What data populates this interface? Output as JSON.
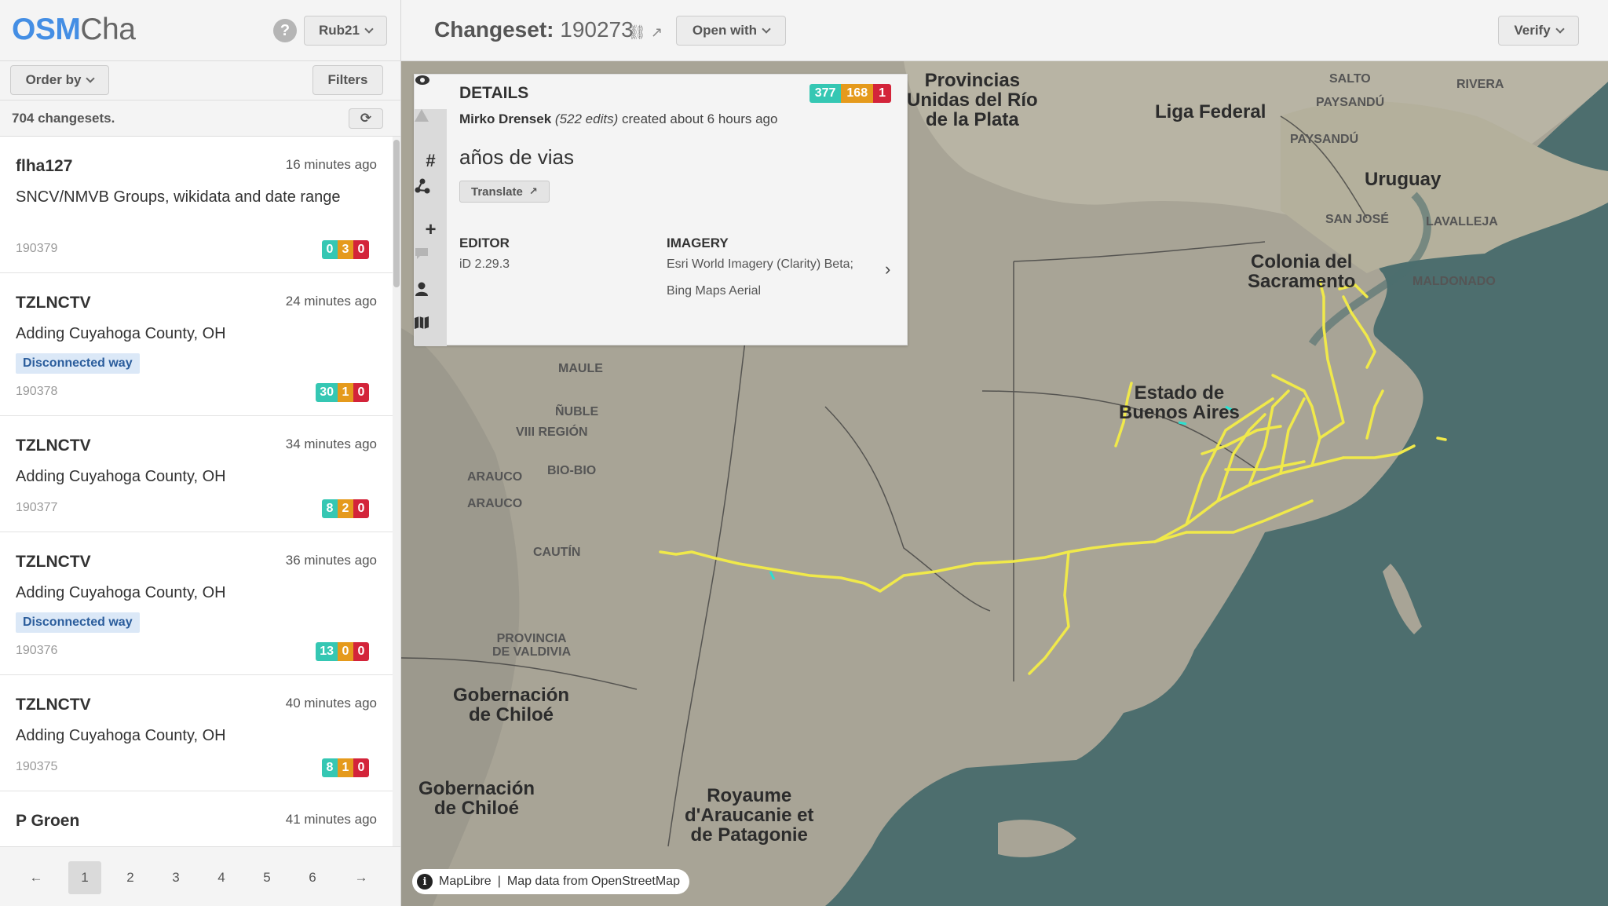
{
  "app": {
    "logo_a": "OSM",
    "logo_b": "Cha",
    "help": "?",
    "user_menu": "Rub21"
  },
  "sidebar": {
    "order_by": "Order by",
    "filters": "Filters",
    "count": "704 changesets.",
    "changesets": [
      {
        "user": "flha127",
        "time": "16 minutes ago",
        "comment": "SNCV/NMVB Groups, wikidata and date range",
        "flag": "",
        "id": "190379",
        "create": "0",
        "modify": "3",
        "delete": "0"
      },
      {
        "user": "TZLNCTV",
        "time": "24 minutes ago",
        "comment": "Adding Cuyahoga County, OH",
        "flag": "Disconnected way",
        "id": "190378",
        "create": "30",
        "modify": "1",
        "delete": "0"
      },
      {
        "user": "TZLNCTV",
        "time": "34 minutes ago",
        "comment": "Adding Cuyahoga County, OH",
        "flag": "",
        "id": "190377",
        "create": "8",
        "modify": "2",
        "delete": "0"
      },
      {
        "user": "TZLNCTV",
        "time": "36 minutes ago",
        "comment": "Adding Cuyahoga County, OH",
        "flag": "Disconnected way",
        "id": "190376",
        "create": "13",
        "modify": "0",
        "delete": "0"
      },
      {
        "user": "TZLNCTV",
        "time": "40 minutes ago",
        "comment": "Adding Cuyahoga County, OH",
        "flag": "",
        "id": "190375",
        "create": "8",
        "modify": "1",
        "delete": "0"
      },
      {
        "user": "P Groen",
        "time": "41 minutes ago",
        "comment": "",
        "flag": "",
        "id": "",
        "create": "",
        "modify": "",
        "delete": ""
      }
    ],
    "pages": {
      "prev": "←",
      "p1": "1",
      "p2": "2",
      "p3": "3",
      "p4": "4",
      "p5": "5",
      "p6": "6",
      "next": "→"
    }
  },
  "topbar": {
    "title_label": "Changeset:",
    "changeset_id": "190273",
    "open_with": "Open with",
    "verify": "Verify"
  },
  "details": {
    "heading": "DETAILS",
    "create": "377",
    "modify": "168",
    "delete": "1",
    "user": "Mirko Drensek",
    "edits": "(522 edits)",
    "created": "created about 6 hours ago",
    "comment": "años de vias",
    "translate": "Translate",
    "editor_label": "EDITOR",
    "editor_value": "iD 2.29.3",
    "imagery_label": "IMAGERY",
    "imagery_line1": "Esri World Imagery (Clarity) Beta;",
    "imagery_line2": "Bing Maps Aerial"
  },
  "map": {
    "labels": {
      "provincias": "Provincias\nUnidas del Río\nde la Plata",
      "liga": "Liga Federal",
      "uruguay": "Uruguay",
      "colonia": "Colonia del\nSacramento",
      "buenos_aires": "Estado de\nBuenos Aires",
      "chiloe1": "Gobernación\nde Chiloé",
      "chiloe2": "Gobernación\nde Chiloé",
      "araucanie": "Royaume\nd'Araucanie et\nde Patagonie",
      "salto": "SALTO",
      "rivera": "RIVERA",
      "paysandu1": "PAYSANDÚ",
      "paysandu2": "PAYSANDÚ",
      "san_jose": "SAN JOSÉ",
      "lavalleja": "LAVALLEJA",
      "maldonado": "MALDONADO",
      "maule": "MAULE",
      "nuble": "ÑUBLE",
      "viii": "VIII REGIÓN",
      "bio_bio": "BIO-BIO",
      "arauco1": "ARAUCO",
      "arauco2": "ARAUCO",
      "cautin": "CAUTÍN",
      "valdivia": "PROVINCIA\nDE VALDIVIA"
    },
    "attribution_a": "MapLibre",
    "attribution_b": "Map data from",
    "attribution_c": "OpenStreetMap"
  },
  "colors": {
    "accent": "#448ee4",
    "create": "#35c7b3",
    "modify": "#e59a1c",
    "delete": "#d3243a",
    "rail": "#f0e94a"
  }
}
